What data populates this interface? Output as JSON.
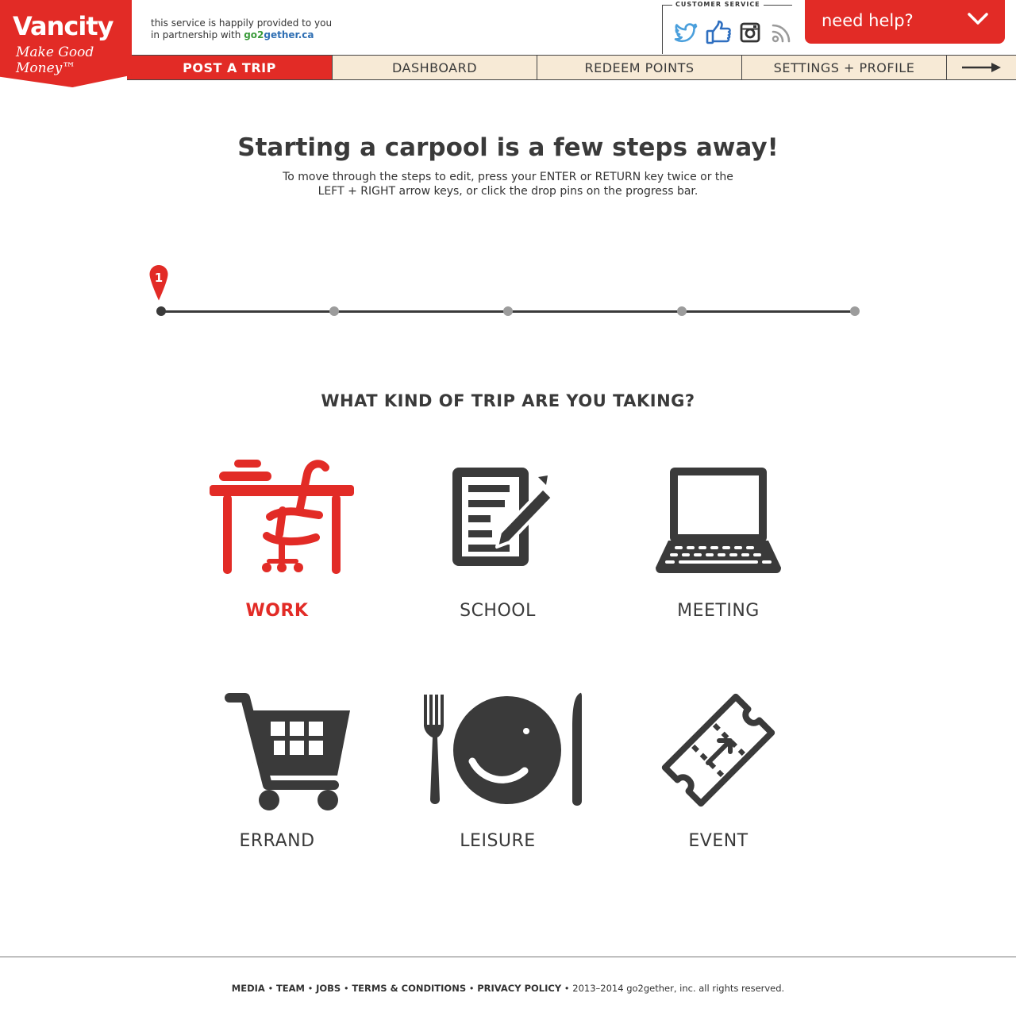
{
  "logo": {
    "name": "Vancity",
    "tagline": "Make Good Money™"
  },
  "partner": {
    "line1": "this service is happily provided to you",
    "line2_prefix": "in partnership with",
    "link_go2": "go2",
    "link_rest": "gether.ca"
  },
  "customer_service": {
    "label": "CUSTOMER SERVICE",
    "icons": [
      "twitter-icon",
      "thumbs-up-icon",
      "instagram-icon",
      "rss-icon"
    ],
    "colors": {
      "twitter": "#4a9fdc",
      "like": "#2f6fc0",
      "instagram": "#333333",
      "rss": "#9a9a9a"
    }
  },
  "help": {
    "label": "need help?"
  },
  "nav": {
    "items": [
      {
        "label": "POST A TRIP",
        "active": true
      },
      {
        "label": "DASHBOARD",
        "active": false
      },
      {
        "label": "REDEEM POINTS",
        "active": false
      },
      {
        "label": "SETTINGS + PROFILE",
        "active": false
      }
    ]
  },
  "hero": {
    "title": "Starting a carpool is a few steps away!",
    "subtitle": "To move through the steps to edit, press your ENTER or RETURN key twice or the LEFT + RIGHT arrow keys, or click the drop pins on the progress bar."
  },
  "progress": {
    "current_step": "1",
    "total_steps": 5
  },
  "question": "WHAT KIND OF TRIP ARE YOU TAKING?",
  "trip_types": [
    {
      "label": "WORK",
      "icon": "desk-chair-icon",
      "selected": true
    },
    {
      "label": "SCHOOL",
      "icon": "document-pencil-icon",
      "selected": false
    },
    {
      "label": "MEETING",
      "icon": "laptop-icon",
      "selected": false
    },
    {
      "label": "ERRAND",
      "icon": "shopping-cart-icon",
      "selected": false
    },
    {
      "label": "LEISURE",
      "icon": "plate-cutlery-icon",
      "selected": false
    },
    {
      "label": "EVENT",
      "icon": "ticket-icon",
      "selected": false
    }
  ],
  "footer": {
    "links": [
      "MEDIA",
      "TEAM",
      "JOBS",
      "TERMS & CONDITIONS",
      "PRIVACY POLICY"
    ],
    "separator": " • ",
    "copyright": "2013–2014 go2gether, inc. all rights reserved."
  },
  "colors": {
    "accent": "#e22b26",
    "nav_bg": "#f7ead6",
    "text": "#3a3a3a",
    "dot": "#9c9c9c"
  }
}
